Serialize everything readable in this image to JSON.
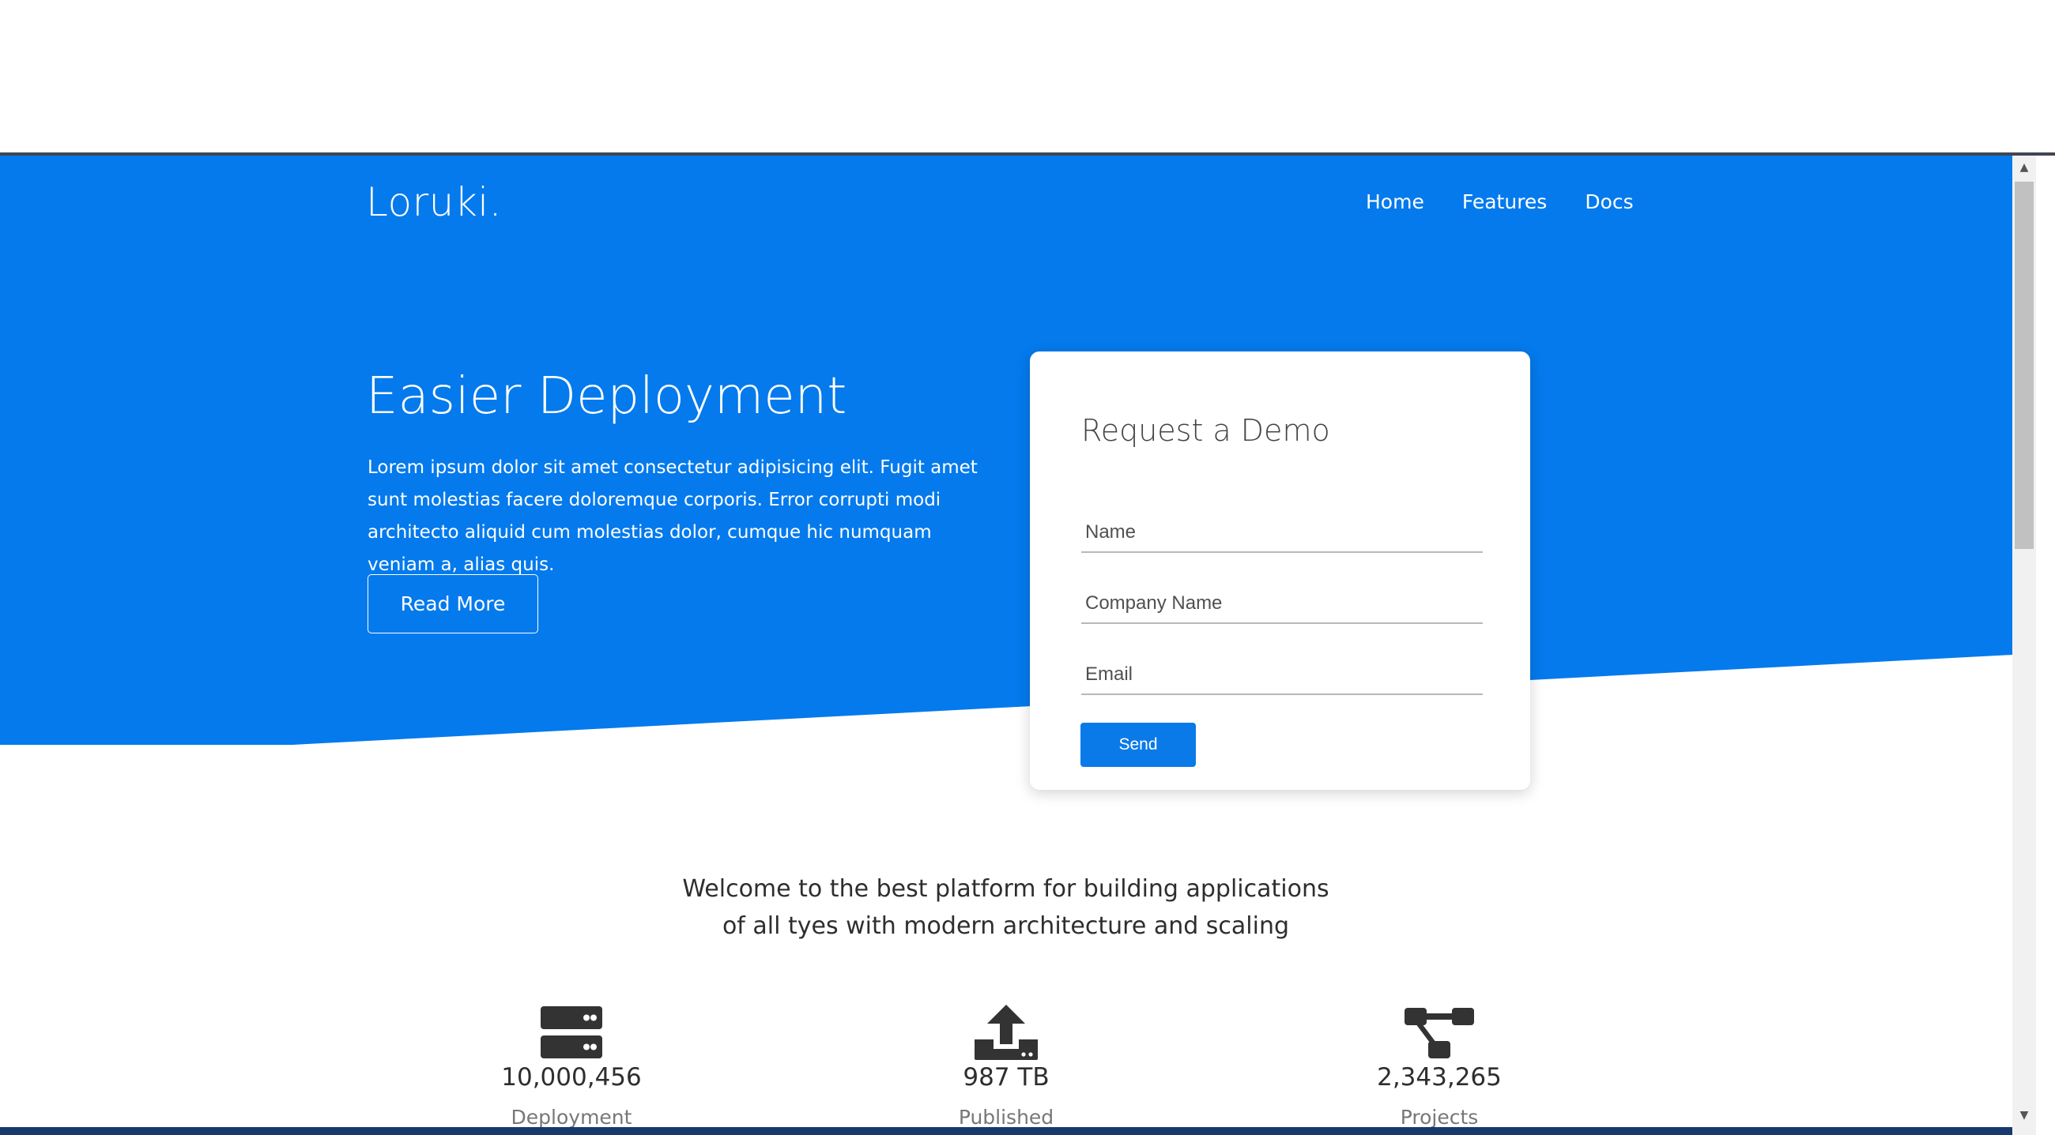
{
  "header": {
    "brand": "Loruki.",
    "nav": [
      {
        "label": "Home"
      },
      {
        "label": "Features"
      },
      {
        "label": "Docs"
      }
    ]
  },
  "hero": {
    "title": "Easier Deployment",
    "text": "Lorem ipsum dolor sit amet consectetur adipisicing elit. Fugit amet sunt molestias facere doloremque corporis. Error corrupti modi architecto aliquid cum molestias dolor, cumque hic numquam veniam a, alias quis.",
    "button_label": "Read More"
  },
  "demo_form": {
    "title": "Request a Demo",
    "fields": [
      {
        "placeholder": "Name",
        "value": ""
      },
      {
        "placeholder": "Company Name",
        "value": ""
      },
      {
        "placeholder": "Email",
        "value": ""
      }
    ],
    "submit_label": "Send"
  },
  "welcome": {
    "text": "Welcome to the best platform for building applications of all tyes with modern architecture and scaling"
  },
  "stats": [
    {
      "icon": "server-icon",
      "value": "10,000,456",
      "label": "Deployment"
    },
    {
      "icon": "upload-icon",
      "value": "987 TB",
      "label": "Published"
    },
    {
      "icon": "project-diagram-icon",
      "value": "2,343,265",
      "label": "Projects"
    }
  ],
  "colors": {
    "primary": "#047aed",
    "button": "#0a7ae9",
    "text_dark": "#2e2e2e",
    "icon_dark": "#333333"
  }
}
